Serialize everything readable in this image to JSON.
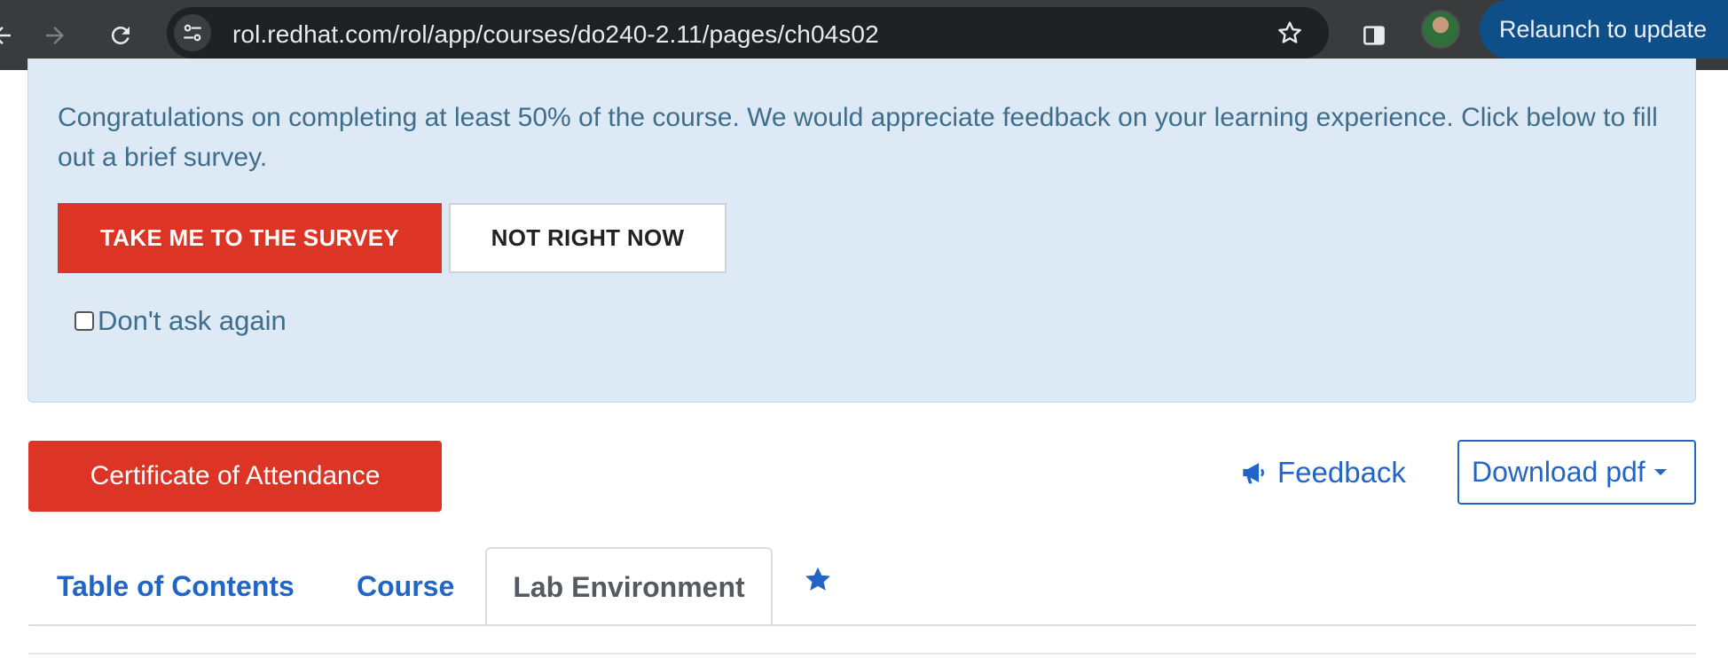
{
  "browser": {
    "url": "rol.redhat.com/rol/app/courses/do240-2.11/pages/ch04s02",
    "relaunch_label": "Relaunch to update"
  },
  "survey": {
    "message": "Congratulations on completing at least 50% of the course. We would appreciate feedback on your learning experience. Click below to fill out a brief survey.",
    "primary_label": "TAKE ME TO THE SURVEY",
    "secondary_label": "NOT RIGHT NOW",
    "dont_ask_label": "Don't ask again",
    "dont_ask_checked": false
  },
  "actions": {
    "certificate_label": "Certificate of Attendance",
    "feedback_label": "Feedback",
    "download_label": "Download pdf"
  },
  "tabs": [
    {
      "label": "Table of Contents",
      "active": false
    },
    {
      "label": "Course",
      "active": false
    },
    {
      "label": "Lab Environment",
      "active": true
    }
  ],
  "colors": {
    "accent_red": "#dc3425",
    "link_blue": "#2165c7",
    "panel_bg": "#dde9f4",
    "panel_text": "#3e6e8c"
  },
  "icons": {
    "back": "arrow-left-icon",
    "forward": "arrow-right-icon",
    "reload": "reload-icon",
    "site_info": "tune-icon",
    "bookmark": "star-outline-icon",
    "side_panel": "side-panel-icon",
    "feedback": "megaphone-icon",
    "favorite_tab": "star-icon"
  }
}
